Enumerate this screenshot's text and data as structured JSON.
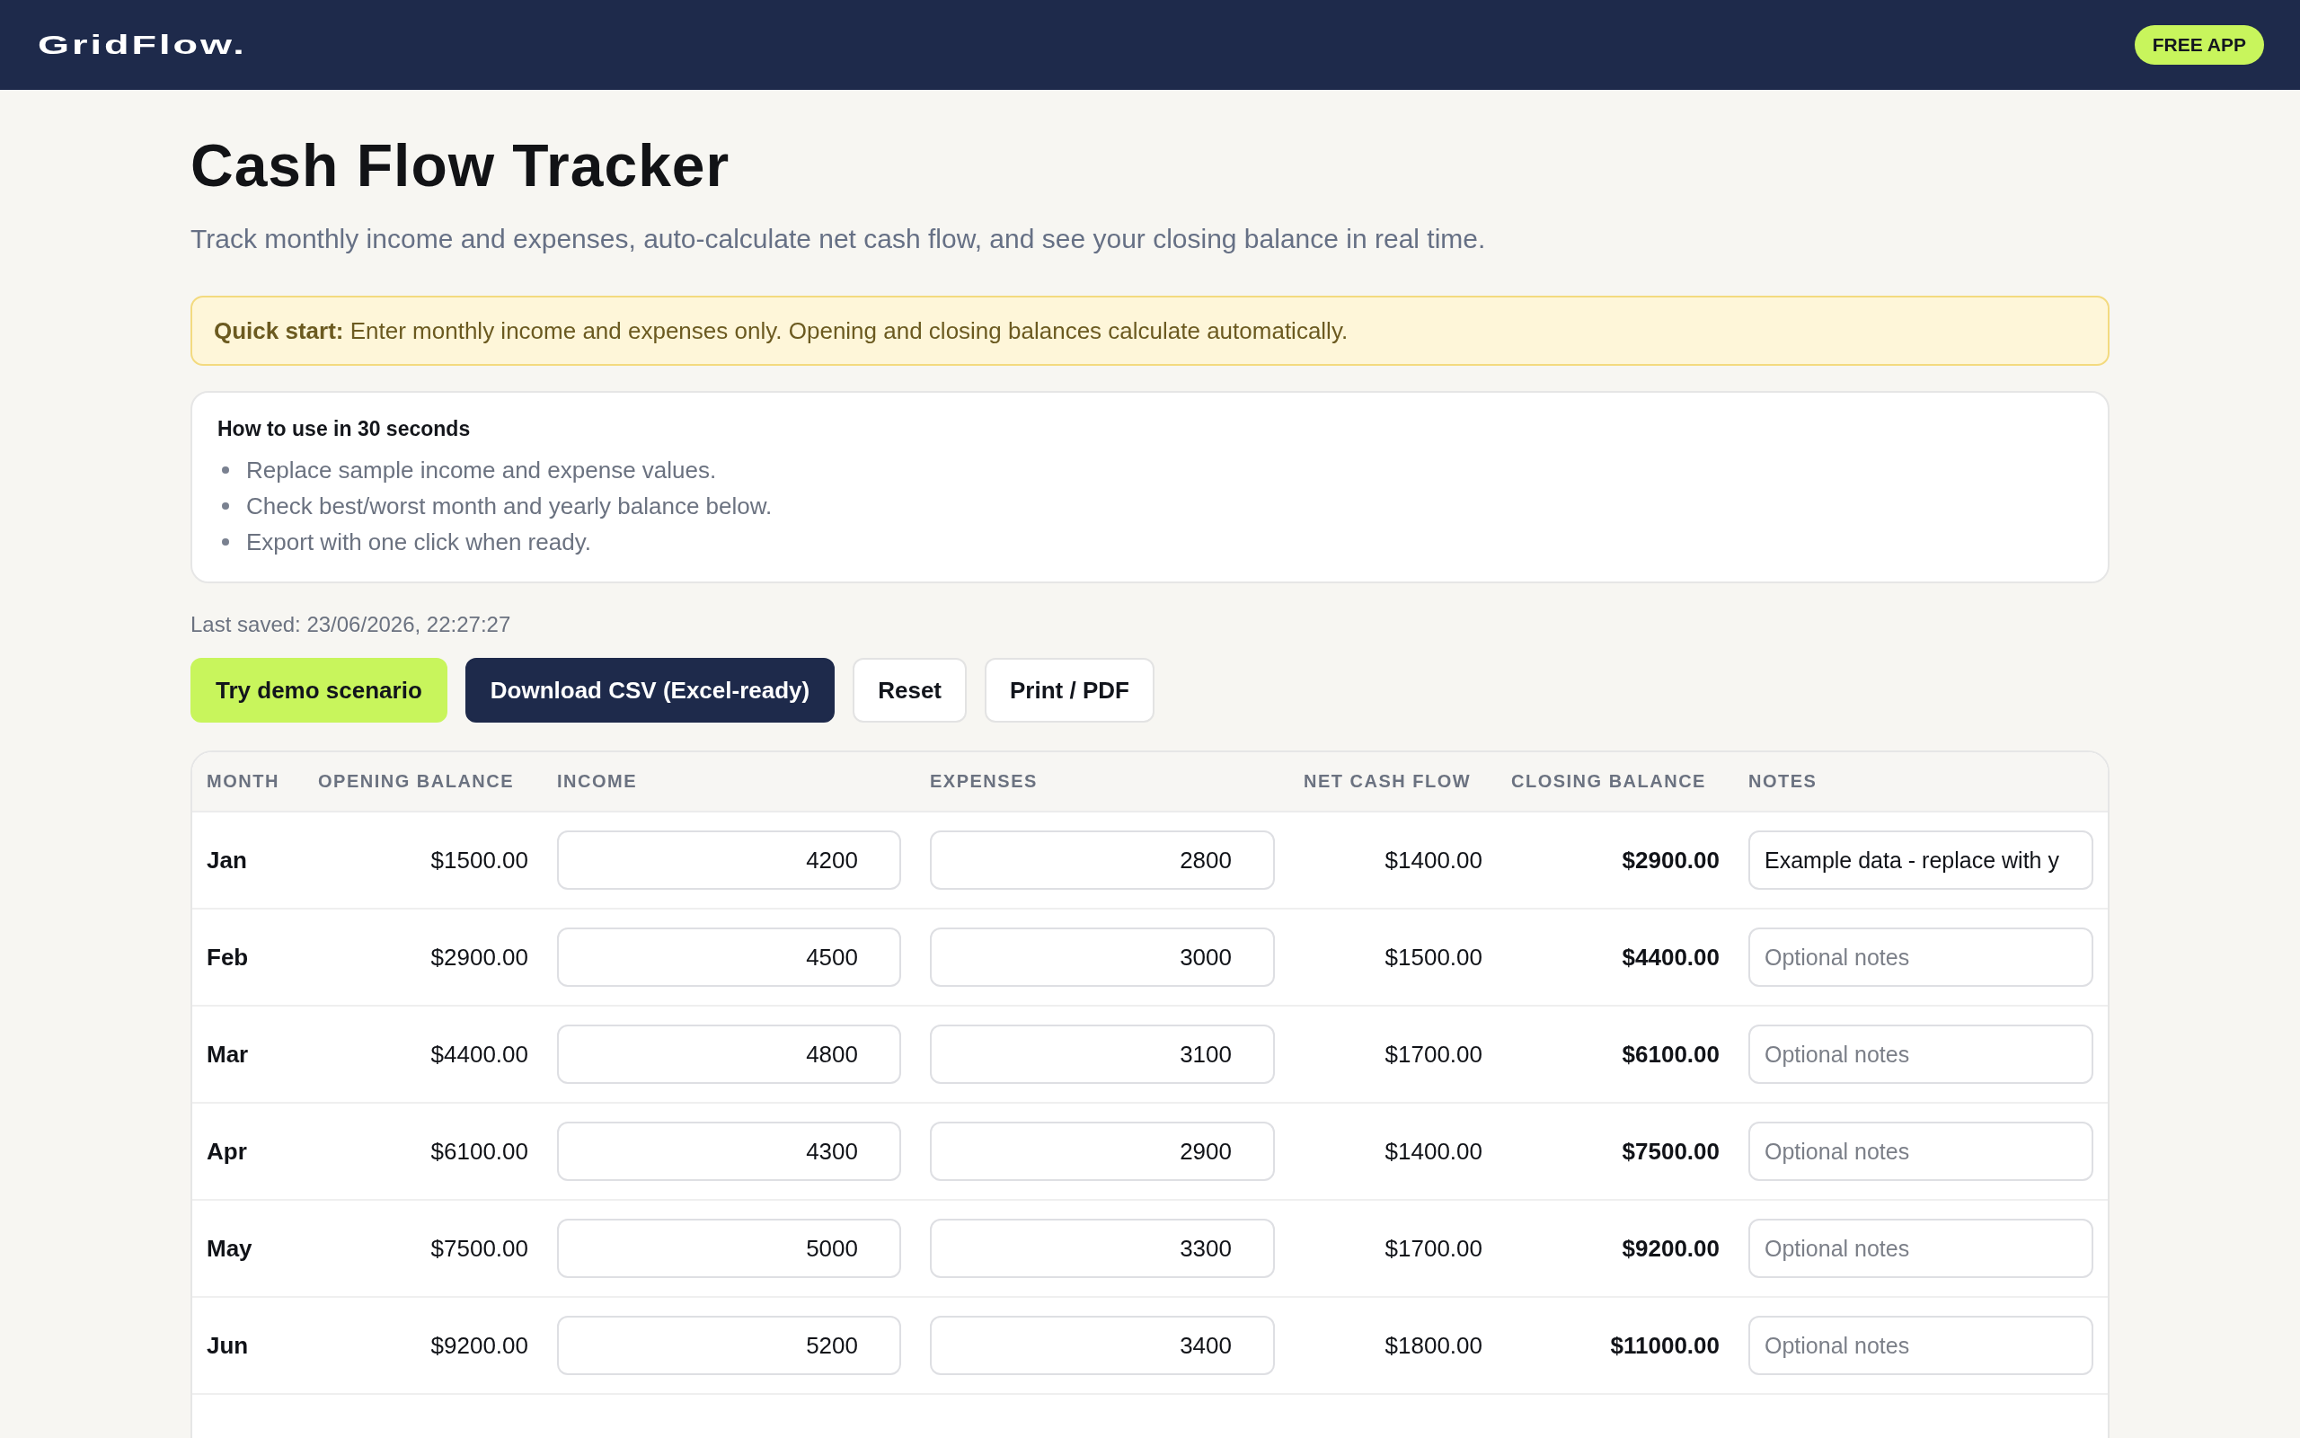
{
  "header": {
    "logo": "GridFlow.",
    "badge": "FREE APP"
  },
  "page": {
    "title": "Cash Flow Tracker",
    "subtitle": "Track monthly income and expenses, auto-calculate net cash flow, and see your closing balance in real time."
  },
  "quick_start": {
    "text": "**Quick start:** Enter monthly income and expenses only. Opening and closing balances calculate automatically."
  },
  "how_to": {
    "title": "How to use in 30 seconds",
    "items": [
      "Replace sample income and expense values.",
      "Check best/worst month and yearly balance below.",
      "Export with one click when ready."
    ]
  },
  "last_saved": "Last saved: 23/06/2026, 22:27:27",
  "actions": [
    {
      "label": "Try demo scenario",
      "kind": "accent"
    },
    {
      "label": "Download CSV (Excel-ready)",
      "kind": "primary"
    },
    {
      "label": "Reset",
      "kind": "secondary"
    },
    {
      "label": "Print / PDF",
      "kind": "secondary"
    }
  ],
  "table": {
    "columns": [
      "MONTH",
      "OPENING BALANCE",
      "INCOME",
      "EXPENSES",
      "NET CASH FLOW",
      "CLOSING BALANCE",
      "NOTES"
    ],
    "rows": [
      {
        "month": "Jan",
        "opening_balance": "$1500.00",
        "income": "4200",
        "expenses": "2800",
        "net_cash_flow": "$1400.00",
        "closing_balance": "$2900.00",
        "notes": {
          "value": "Example data - replace with y"
        }
      },
      {
        "month": "Feb",
        "opening_balance": "$2900.00",
        "income": "4500",
        "expenses": "3000",
        "net_cash_flow": "$1500.00",
        "closing_balance": "$4400.00",
        "notes": {
          "placeholder": "Optional notes"
        }
      },
      {
        "month": "Mar",
        "opening_balance": "$4400.00",
        "income": "4800",
        "expenses": "3100",
        "net_cash_flow": "$1700.00",
        "closing_balance": "$6100.00",
        "notes": {
          "placeholder": "Optional notes"
        }
      },
      {
        "month": "Apr",
        "opening_balance": "$6100.00",
        "income": "4300",
        "expenses": "2900",
        "net_cash_flow": "$1400.00",
        "closing_balance": "$7500.00",
        "notes": {
          "placeholder": "Optional notes"
        }
      },
      {
        "month": "May",
        "opening_balance": "$7500.00",
        "income": "5000",
        "expenses": "3300",
        "net_cash_flow": "$1700.00",
        "closing_balance": "$9200.00",
        "notes": {
          "placeholder": "Optional notes"
        }
      },
      {
        "month": "Jun",
        "opening_balance": "$9200.00",
        "income": "5200",
        "expenses": "3400",
        "net_cash_flow": "$1800.00",
        "closing_balance": "$11000.00",
        "notes": {
          "placeholder": "Optional notes"
        }
      }
    ]
  }
}
